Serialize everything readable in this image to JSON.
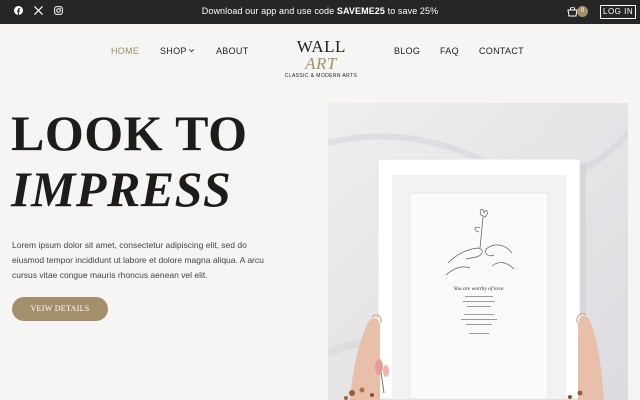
{
  "topbar": {
    "promo_prefix": "Download our app and use code ",
    "promo_code": "SAVEME25",
    "promo_suffix": " to save 25%",
    "socials": [
      "facebook-icon",
      "x-icon",
      "instagram-icon"
    ],
    "cart_count": "0",
    "login_label": "LOG IN"
  },
  "nav": {
    "home": "HOME",
    "shop": "SHOP",
    "about": "ABOUT",
    "blog": "BLOG",
    "faq": "FAQ",
    "contact": "CONTACT"
  },
  "logo": {
    "wall": "WALL",
    "art": "ART",
    "tagline": "CLASSIC & MODERN ARTS"
  },
  "hero": {
    "line1": "LOOK TO",
    "line2": "IMPRESS",
    "description": "Lorem ipsum dolor sit amet, consectetur adipiscing elit, sed do eiusmod tempor incididunt ut labore et dolore magna aliqua. A arcu cursus vitae congue mauris rhoncus aenean vel elit.",
    "button_label": "VEIW DETAILS"
  },
  "print": {
    "caption": "You are worthy of love."
  },
  "colors": {
    "accent": "#a38f6c",
    "topbar": "#262626",
    "background": "#f6f5f3"
  }
}
